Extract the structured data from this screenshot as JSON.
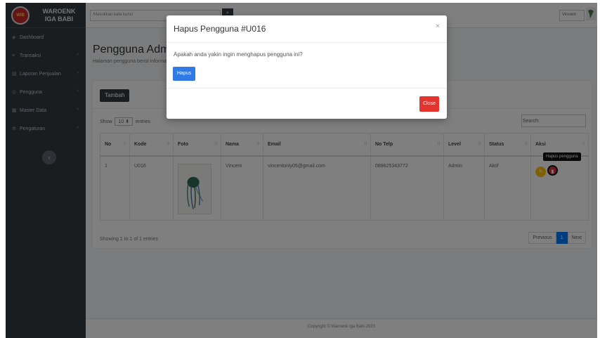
{
  "brand": {
    "line1": "WAROENK",
    "line2": "IGA BABI",
    "logo_text": "WIB"
  },
  "sidebar": {
    "items": [
      {
        "label": "Dashboard",
        "icon": "dashboard-icon",
        "chevron": false
      },
      {
        "label": "Transaksi",
        "icon": "list-icon",
        "chevron": true
      },
      {
        "label": "Laporan Penjualan",
        "icon": "report-icon",
        "chevron": true
      },
      {
        "label": "Pengguna",
        "icon": "users-icon",
        "chevron": true
      },
      {
        "label": "Master Data",
        "icon": "database-icon",
        "chevron": true
      },
      {
        "label": "Pengaturan",
        "icon": "gear-icon",
        "chevron": true
      }
    ],
    "collapse_glyph": "‹"
  },
  "topbar": {
    "search_placeholder": "Masukkan kata kunci",
    "user_name": "Vincent"
  },
  "page": {
    "title": "Pengguna Admin",
    "subtitle": "Halaman pengguna berisi informasi"
  },
  "card": {
    "add_button": "Tambah",
    "show": "Show",
    "entries_value": "10",
    "entries": "entries",
    "search_label": "Search:",
    "columns": [
      "No",
      "Kode",
      "Foto",
      "Nama",
      "Email",
      "No Telp",
      "Level",
      "Status",
      "Aksi"
    ],
    "row": {
      "no": "1",
      "kode": "U016",
      "nama": "Vincent",
      "email": "vincentonly05@gmail.com",
      "telp": "089625343772",
      "level": "Admin",
      "status": "Aktif"
    },
    "tooltip": "Hapus pengguna",
    "showing": "Showing 1 to 1 of 1 entries",
    "pager": {
      "prev": "Previous",
      "current": "1",
      "next": "Next"
    }
  },
  "footer": {
    "text": "Copyright © Waroenk Iga Babi 2023"
  },
  "modal": {
    "title": "Hapus Pengguna #U016",
    "close_glyph": "×",
    "message": "Apakah anda yakin ingin menghapus pengguna ini?",
    "confirm_label": "Hapus",
    "close_label": "Close"
  },
  "colors": {
    "sidebar_bg": "#343a40",
    "primary": "#2f7ae5",
    "danger": "#e3342f",
    "warning": "#ffc107",
    "pager_active": "#007bff"
  }
}
